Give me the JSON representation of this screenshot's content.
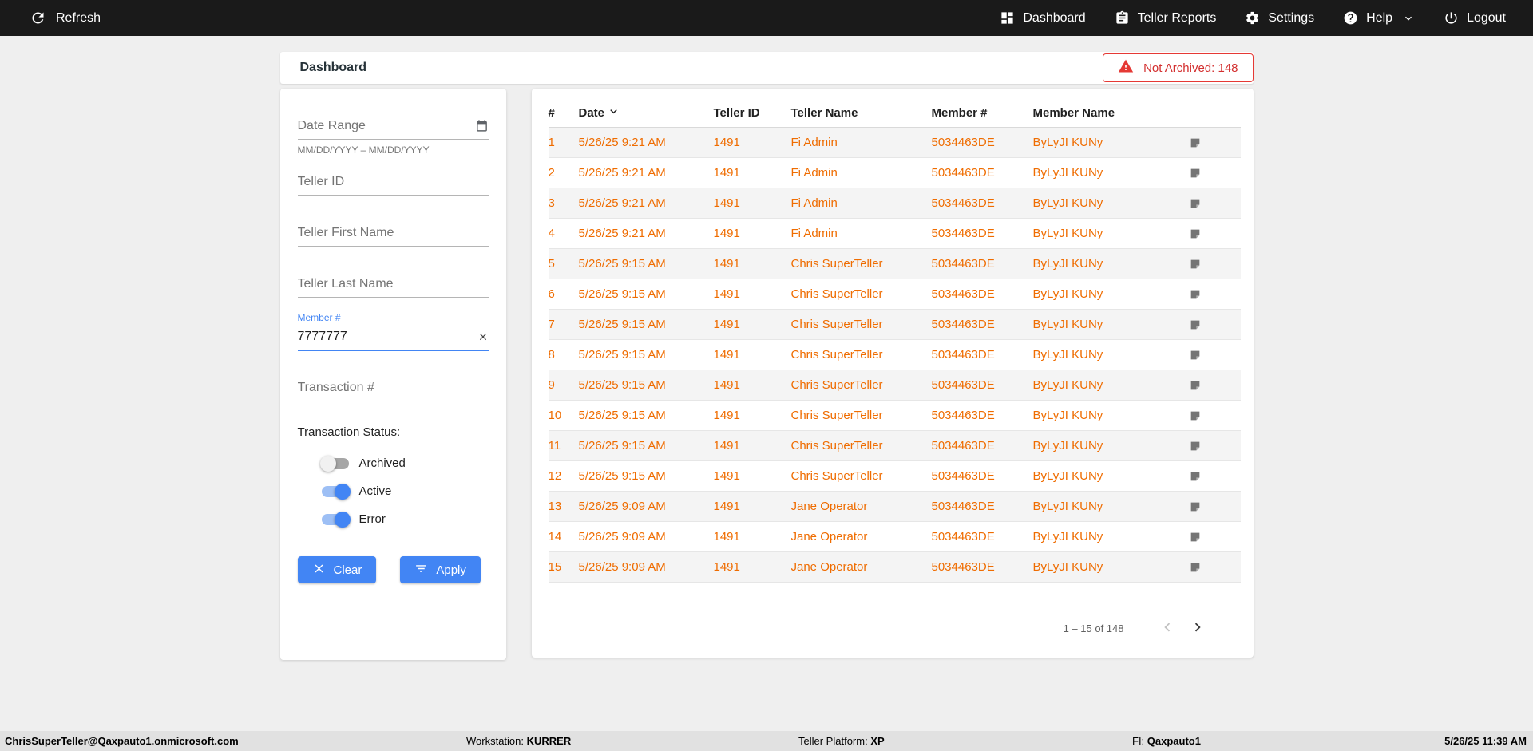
{
  "topbar": {
    "refresh_label": "Refresh",
    "nav": [
      {
        "label": "Dashboard"
      },
      {
        "label": "Teller Reports"
      },
      {
        "label": "Settings"
      },
      {
        "label": "Help"
      },
      {
        "label": "Logout"
      }
    ]
  },
  "header": {
    "title": "Dashboard",
    "not_archived": "Not Archived: 148"
  },
  "filters": {
    "date_range": {
      "placeholder": "Date Range",
      "hint": "MM/DD/YYYY – MM/DD/YYYY"
    },
    "teller_id": {
      "placeholder": "Teller ID"
    },
    "teller_first_name": {
      "placeholder": "Teller First Name"
    },
    "teller_last_name": {
      "placeholder": "Teller Last Name"
    },
    "member": {
      "label": "Member #",
      "value": "7777777"
    },
    "transaction": {
      "placeholder": "Transaction #"
    },
    "status_label": "Transaction Status:",
    "toggles": [
      {
        "label": "Archived",
        "on": false
      },
      {
        "label": "Active",
        "on": true
      },
      {
        "label": "Error",
        "on": true
      }
    ],
    "clear_label": "Clear",
    "apply_label": "Apply"
  },
  "table": {
    "columns": {
      "num": "#",
      "date": "Date",
      "teller_id": "Teller ID",
      "teller_name": "Teller Name",
      "member_num": "Member #",
      "member_name": "Member Name"
    },
    "rows": [
      {
        "num": "1",
        "date": "5/26/25 9:21 AM",
        "teller_id": "1491",
        "teller_name": "Fi Admin",
        "member_num": "5034463DE",
        "member_name": "ByLyJI KUNy"
      },
      {
        "num": "2",
        "date": "5/26/25 9:21 AM",
        "teller_id": "1491",
        "teller_name": "Fi Admin",
        "member_num": "5034463DE",
        "member_name": "ByLyJI KUNy"
      },
      {
        "num": "3",
        "date": "5/26/25 9:21 AM",
        "teller_id": "1491",
        "teller_name": "Fi Admin",
        "member_num": "5034463DE",
        "member_name": "ByLyJI KUNy"
      },
      {
        "num": "4",
        "date": "5/26/25 9:21 AM",
        "teller_id": "1491",
        "teller_name": "Fi Admin",
        "member_num": "5034463DE",
        "member_name": "ByLyJI KUNy"
      },
      {
        "num": "5",
        "date": "5/26/25 9:15 AM",
        "teller_id": "1491",
        "teller_name": "Chris SuperTeller",
        "member_num": "5034463DE",
        "member_name": "ByLyJI KUNy"
      },
      {
        "num": "6",
        "date": "5/26/25 9:15 AM",
        "teller_id": "1491",
        "teller_name": "Chris SuperTeller",
        "member_num": "5034463DE",
        "member_name": "ByLyJI KUNy"
      },
      {
        "num": "7",
        "date": "5/26/25 9:15 AM",
        "teller_id": "1491",
        "teller_name": "Chris SuperTeller",
        "member_num": "5034463DE",
        "member_name": "ByLyJI KUNy"
      },
      {
        "num": "8",
        "date": "5/26/25 9:15 AM",
        "teller_id": "1491",
        "teller_name": "Chris SuperTeller",
        "member_num": "5034463DE",
        "member_name": "ByLyJI KUNy"
      },
      {
        "num": "9",
        "date": "5/26/25 9:15 AM",
        "teller_id": "1491",
        "teller_name": "Chris SuperTeller",
        "member_num": "5034463DE",
        "member_name": "ByLyJI KUNy"
      },
      {
        "num": "10",
        "date": "5/26/25 9:15 AM",
        "teller_id": "1491",
        "teller_name": "Chris SuperTeller",
        "member_num": "5034463DE",
        "member_name": "ByLyJI KUNy"
      },
      {
        "num": "11",
        "date": "5/26/25 9:15 AM",
        "teller_id": "1491",
        "teller_name": "Chris SuperTeller",
        "member_num": "5034463DE",
        "member_name": "ByLyJI KUNy"
      },
      {
        "num": "12",
        "date": "5/26/25 9:15 AM",
        "teller_id": "1491",
        "teller_name": "Chris SuperTeller",
        "member_num": "5034463DE",
        "member_name": "ByLyJI KUNy"
      },
      {
        "num": "13",
        "date": "5/26/25 9:09 AM",
        "teller_id": "1491",
        "teller_name": "Jane Operator",
        "member_num": "5034463DE",
        "member_name": "ByLyJI KUNy"
      },
      {
        "num": "14",
        "date": "5/26/25 9:09 AM",
        "teller_id": "1491",
        "teller_name": "Jane Operator",
        "member_num": "5034463DE",
        "member_name": "ByLyJI KUNy"
      },
      {
        "num": "15",
        "date": "5/26/25 9:09 AM",
        "teller_id": "1491",
        "teller_name": "Jane Operator",
        "member_num": "5034463DE",
        "member_name": "ByLyJI KUNy"
      }
    ],
    "pagination_range": "1 – 15 of 148"
  },
  "statusbar": {
    "user": "ChrisSuperTeller@Qaxpauto1.onmicrosoft.com",
    "workstation_label": "Workstation: ",
    "workstation_value": "KURRER",
    "platform_label": "Teller Platform: ",
    "platform_value": "XP",
    "fi_label": "FI: ",
    "fi_value": "Qaxpauto1",
    "datetime": "5/26/25 11:39 AM"
  },
  "colors": {
    "topbar_bg": "#1a1a1a",
    "accent_blue": "#4285f4",
    "data_orange": "#ef6c00",
    "alert_red": "#e53935",
    "page_bg": "#efefef"
  }
}
